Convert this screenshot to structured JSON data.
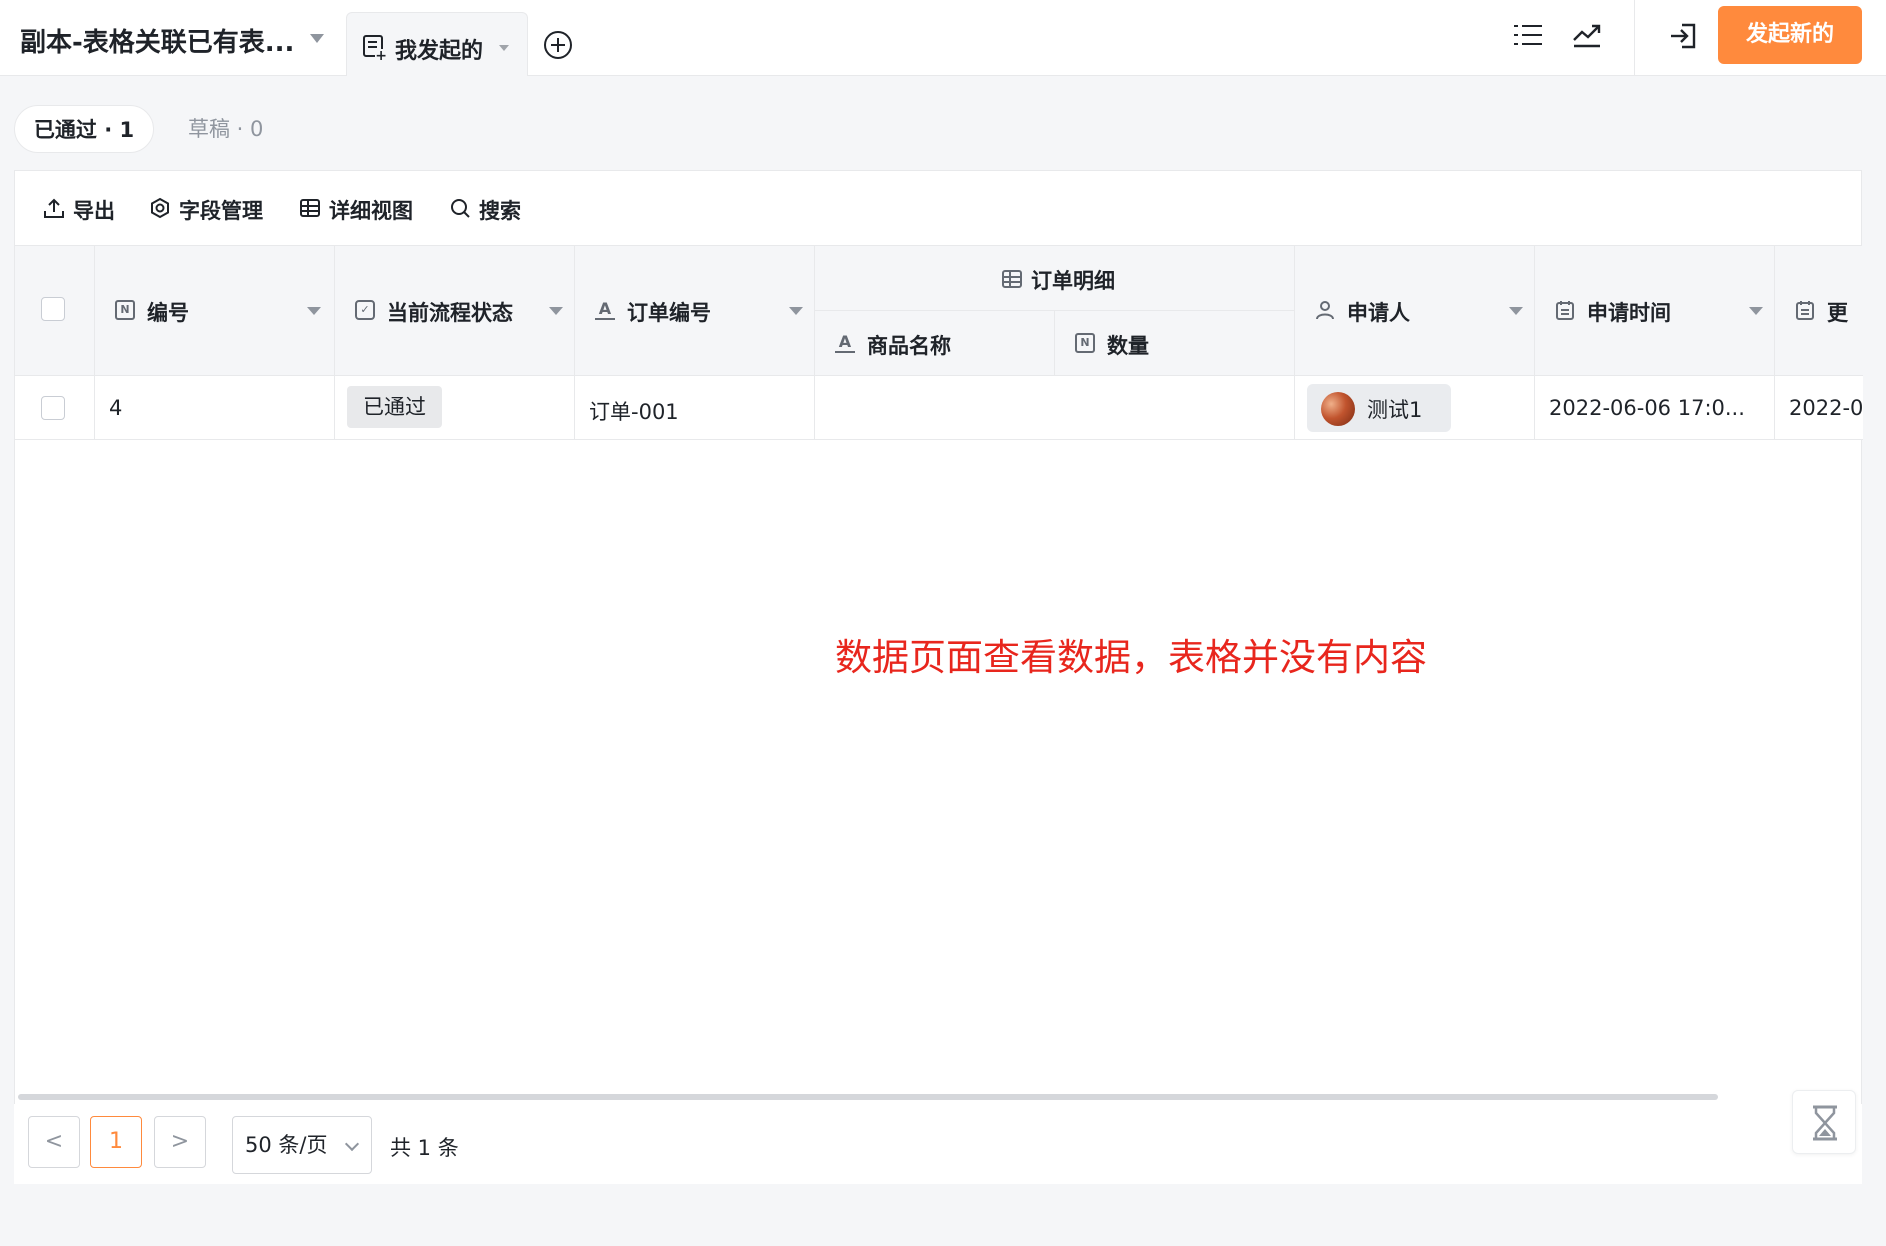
{
  "header": {
    "app_title": "副本-表格关联已有表...",
    "view_tab_label": "我发起的",
    "launch_button": "发起新的",
    "icons": [
      "list-icon",
      "trend-icon",
      "exit-icon",
      "add-view-icon"
    ]
  },
  "status_tabs": [
    {
      "label": "已通过 · 1",
      "active": true
    },
    {
      "label": "草稿 · 0",
      "active": false
    }
  ],
  "toolbar": {
    "export": "导出",
    "fields": "字段管理",
    "detail_view": "详细视图",
    "search": "搜索"
  },
  "table": {
    "group_header": "订单明细",
    "columns": {
      "id": "编号",
      "status": "当前流程状态",
      "order_no": "订单编号",
      "product": "商品名称",
      "qty": "数量",
      "applicant": "申请人",
      "apply_time": "申请时间",
      "update_time": "更"
    },
    "rows": [
      {
        "id": "4",
        "status": "已通过",
        "order_no": "订单-001",
        "product": "",
        "qty": "",
        "applicant": "测试1",
        "apply_time": "2022-06-06 17:0...",
        "update_time": "2022-0"
      }
    ]
  },
  "annotation": "数据页面查看数据，表格并没有内容",
  "pagination": {
    "prev": "<",
    "current_page": "1",
    "next": ">",
    "page_size": "50 条/页",
    "total": "共 1 条"
  },
  "colors": {
    "accent": "#ff8a3d",
    "annotation": "#e8261d"
  }
}
